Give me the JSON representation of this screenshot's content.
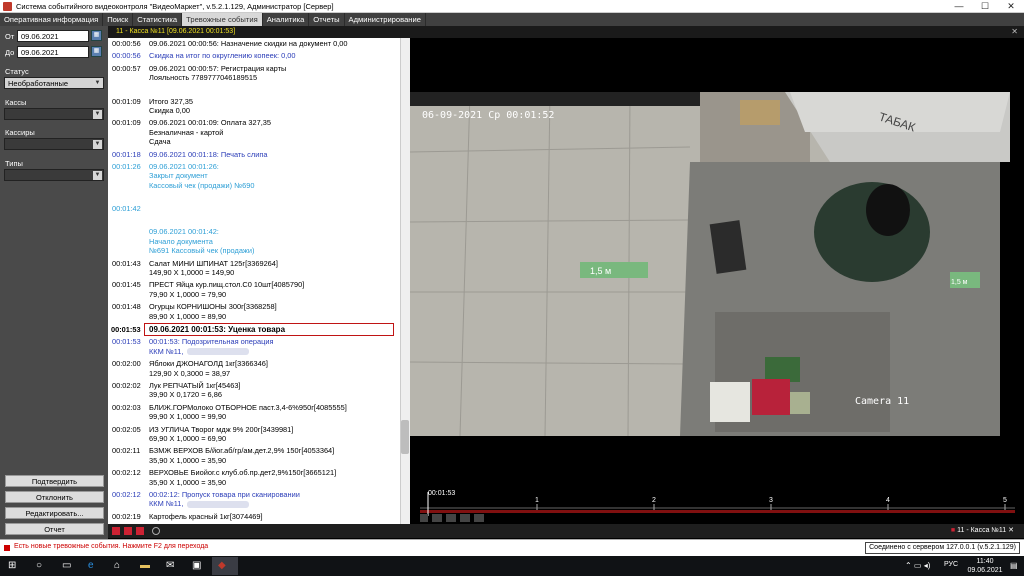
{
  "window": {
    "title": "Система событийного видеоконтроля \"ВидеоМаркет\", v.5.2.1.129, Администратор [Сервер]",
    "minimize": "—",
    "maximize": "☐",
    "close": "✕"
  },
  "menu": [
    {
      "label": "Оперативная информация",
      "active": false
    },
    {
      "label": "Поиск",
      "active": false
    },
    {
      "label": "Статистика",
      "active": false
    },
    {
      "label": "Тревожные события",
      "active": true
    },
    {
      "label": "Аналитика",
      "active": false
    },
    {
      "label": "Отчеты",
      "active": false
    },
    {
      "label": "Администрирование",
      "active": false
    }
  ],
  "filters": {
    "from_label": "От",
    "from_value": "09.06.2021",
    "to_label": "До",
    "to_value": "09.06.2021",
    "status_label": "Статус",
    "status_value": "Необработанные",
    "kassy_label": "Кассы",
    "kassiry_label": "Кассиры",
    "tipy_label": "Типы"
  },
  "actions": {
    "confirm": "Подтвердить",
    "reject": "Отклонить",
    "edit": "Редактировать...",
    "report": "Отчет"
  },
  "panel": {
    "header": "11 - Касса №11   [09.06.2021 00:01:53]",
    "footer_label": "11 - Касса №11"
  },
  "events": [
    {
      "time": "00:00:56",
      "style": "black",
      "lines": [
        "09.06.2021 00:00:56: Назначение скидки на документ 0,00"
      ]
    },
    {
      "time": "00:00:56",
      "style": "blue",
      "lines": [
        "Скидка на итог по округлению копеек:  0,00"
      ]
    },
    {
      "time": "00:00:57",
      "style": "black",
      "lines": [
        "09.06.2021 00:00:57: Регистрация карты",
        "Лояльность 7789777046189515"
      ]
    },
    {
      "time": "",
      "style": "spacer",
      "lines": []
    },
    {
      "time": "00:01:09",
      "style": "black",
      "lines": [
        "Итого 327,35",
        "Скидка 0,00"
      ]
    },
    {
      "time": "00:01:09",
      "style": "black",
      "lines": [
        "09.06.2021 00:01:09: Оплата 327,35",
        "Безналичная - картой",
        "Сдача"
      ]
    },
    {
      "time": "00:01:18",
      "style": "blue",
      "lines": [
        "09.06.2021 00:01:18: Печать слипа"
      ]
    },
    {
      "time": "00:01:26",
      "style": "cyan",
      "lines": [
        " 09.06.2021 00:01:26:",
        "Закрыт документ",
        "Кассовый чек (продажи) №690"
      ]
    },
    {
      "time": "",
      "style": "spacer",
      "lines": []
    },
    {
      "time": "00:01:42",
      "style": "cyan",
      "lines": [
        ""
      ]
    },
    {
      "time": "",
      "style": "spacer",
      "lines": []
    },
    {
      "time": "",
      "style": "cyan",
      "lines": [
        " 09.06.2021 00:01:42:",
        " Начало документа",
        " №691 Кассовый чек (продажи)"
      ]
    },
    {
      "time": "00:01:43",
      "style": "black",
      "lines": [
        "Салат МИНИ ШПИНАТ 125г[3369264]",
        "149,90 X 1,0000 = 149,90"
      ]
    },
    {
      "time": "00:01:45",
      "style": "black",
      "lines": [
        "ПРЕСТ Яйца кур.пищ.стол.С0 10шт[4085790]",
        "79,90 X 1,0000 = 79,90"
      ]
    },
    {
      "time": "00:01:48",
      "style": "black",
      "lines": [
        "Огурцы КОРНИШОНЫ 300г[3368258]",
        "89,90 X 1,0000 = 89,90"
      ]
    },
    {
      "time": "00:01:53",
      "style": "sel",
      "lines": [
        "09.06.2021 00:01:53: Уценка товара"
      ]
    },
    {
      "time": "00:01:53",
      "style": "blue",
      "lines": [
        "00:01:53: Подозрительная операция",
        "ККМ №11,"
      ],
      "blur": true
    },
    {
      "time": "00:02:00",
      "style": "black",
      "lines": [
        "Яблоки ДЖОНАГОЛД 1кг[3366346]",
        "129,90 X 0,3000 = 38,97"
      ]
    },
    {
      "time": "00:02:02",
      "style": "black",
      "lines": [
        "Лук РЕПЧАТЫЙ 1кг[45463]",
        "39,90 X 0,1720 = 6,86"
      ]
    },
    {
      "time": "00:02:03",
      "style": "black",
      "lines": [
        "БЛИЖ.ГОРМолоко ОТБОРНОЕ паст.3,4-6%950г[4085555]",
        "99,90 X 1,0000 = 99,90"
      ]
    },
    {
      "time": "00:02:05",
      "style": "black",
      "lines": [
        " ИЗ УГЛИЧА Творог мдж 9% 200г[3439981]",
        "69,90 X 1,0000 = 69,90"
      ]
    },
    {
      "time": "00:02:11",
      "style": "black",
      "lines": [
        "БЗМЖ ВЕРХОВ Б/йог.аб/гр/ам.дет.2,9% 150г[4053364]",
        "35,90 X 1,0000 = 35,90"
      ]
    },
    {
      "time": "00:02:12",
      "style": "black",
      "lines": [
        "ВЕРХОВЬЕ Биойог.с клуб.об.пр.дет2,9%150г[3665121]",
        "35,90 X 1,0000 = 35,90"
      ]
    },
    {
      "time": "00:02:12",
      "style": "blue",
      "lines": [
        "00:02:12: Пропуск товара при сканировании",
        "ККМ №11,"
      ],
      "blur": true
    },
    {
      "time": "00:02:19",
      "style": "black",
      "lines": [
        "Картофель красный 1кг[3074469]"
      ]
    }
  ],
  "video": {
    "osd_datetime": "06-09-2021 Ср 00:01:52",
    "camera_label": "Camera 11",
    "shelf_sign": "ТАБАК",
    "floor_marks": [
      "1,5 м",
      "1,5 м"
    ]
  },
  "timeline": {
    "current": "00:01:53",
    "ticks": [
      "1",
      "2",
      "3",
      "4",
      "5"
    ]
  },
  "status": {
    "alert": "Есть новые тревожные события. Нажмите F2 для перехода",
    "connection": "Соединено с сервером 127.0.0.1 (v.5.2.1.129)"
  },
  "taskbar": {
    "lang": "РУС",
    "time": "11:40",
    "date": "09.06.2021"
  },
  "colors": {
    "menubar": "#404040",
    "sidebar": "#4a4a4a",
    "header_text": "#f0e020",
    "blue_event": "#2b3db8",
    "cyan_event": "#2e9fd6",
    "selected_border": "#c01414"
  }
}
